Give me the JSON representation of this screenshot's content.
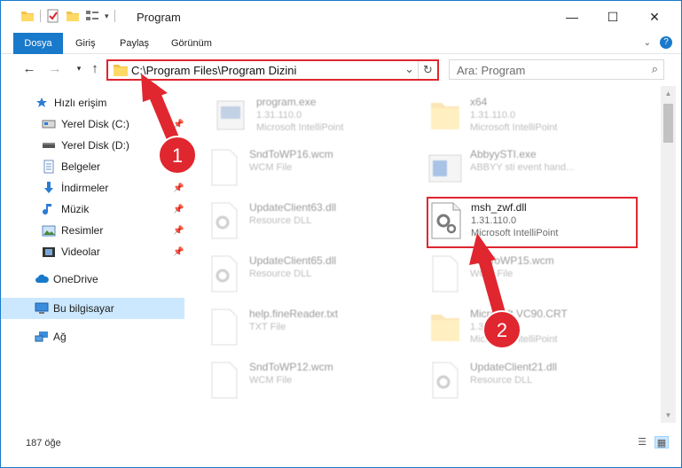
{
  "window": {
    "title": "Program",
    "controls": {
      "minimize": "—",
      "maximize": "☐",
      "close": "✕"
    }
  },
  "ribbon": {
    "tabs": [
      "Dosya",
      "Giriş",
      "Paylaş",
      "Görünüm"
    ],
    "help": "?"
  },
  "address": {
    "path": "C:\\Program Files\\Program Dizini",
    "search_placeholder": "Ara: Program"
  },
  "sidebar": {
    "items": [
      {
        "label": "Hızlı erişim",
        "icon": "star-icon"
      },
      {
        "label": "Yerel Disk (C:)",
        "icon": "disk-icon",
        "pinned": true
      },
      {
        "label": "Yerel Disk (D:)",
        "icon": "disk-icon",
        "pinned": true
      },
      {
        "label": "Belgeler",
        "icon": "documents-icon",
        "pinned": true
      },
      {
        "label": "İndirmeler",
        "icon": "download-icon",
        "pinned": true
      },
      {
        "label": "Müzik",
        "icon": "music-icon",
        "pinned": true
      },
      {
        "label": "Resimler",
        "icon": "pictures-icon",
        "pinned": true
      },
      {
        "label": "Videolar",
        "icon": "videos-icon",
        "pinned": true
      },
      {
        "label": "OneDrive",
        "icon": "cloud-icon"
      },
      {
        "label": "Bu bilgisayar",
        "icon": "computer-icon",
        "selected": true
      },
      {
        "label": "Ağ",
        "icon": "network-icon"
      }
    ]
  },
  "files": [
    {
      "name": "program.exe",
      "version": "1.31.110.0",
      "desc": "Microsoft IntelliPoint",
      "icon": "exe-icon"
    },
    {
      "name": "x64",
      "version": "1.31.110.0",
      "desc": "Microsoft IntelliPoint",
      "icon": "folder-icon"
    },
    {
      "name": "SndToWP16.wcm",
      "version": "WCM File",
      "desc": "",
      "icon": "file-icon"
    },
    {
      "name": "AbbyySTI.exe",
      "version": "ABBYY sti event hand...",
      "desc": "",
      "icon": "exe-icon"
    },
    {
      "name": "UpdateClient63.dll",
      "version": "Resource DLL",
      "desc": "",
      "icon": "dll-icon"
    },
    {
      "name": "msh_zwf.dll",
      "version": "1.31.110.0",
      "desc": "Microsoft IntelliPoint",
      "icon": "dll-icon",
      "highlight": true
    },
    {
      "name": "UpdateClient65.dll",
      "version": "Resource DLL",
      "desc": "",
      "icon": "dll-icon"
    },
    {
      "name": "SndToWP15.wcm",
      "version": "WCM File",
      "desc": "",
      "icon": "file-icon"
    },
    {
      "name": "help.fineReader.txt",
      "version": "TXT File",
      "desc": "",
      "icon": "file-icon"
    },
    {
      "name": "Microsoft.VC90.CRT",
      "version": "1.31.110.0",
      "desc": "Microsoft IntelliPoint",
      "icon": "folder-icon"
    },
    {
      "name": "SndToWP12.wcm",
      "version": "WCM File",
      "desc": "",
      "icon": "file-icon"
    },
    {
      "name": "UpdateClient21.dll",
      "version": "Resource DLL",
      "desc": "",
      "icon": "dll-icon"
    }
  ],
  "status": {
    "count": "187 öğe"
  },
  "callouts": {
    "one": "1",
    "two": "2",
    "color": "#e0262f"
  }
}
